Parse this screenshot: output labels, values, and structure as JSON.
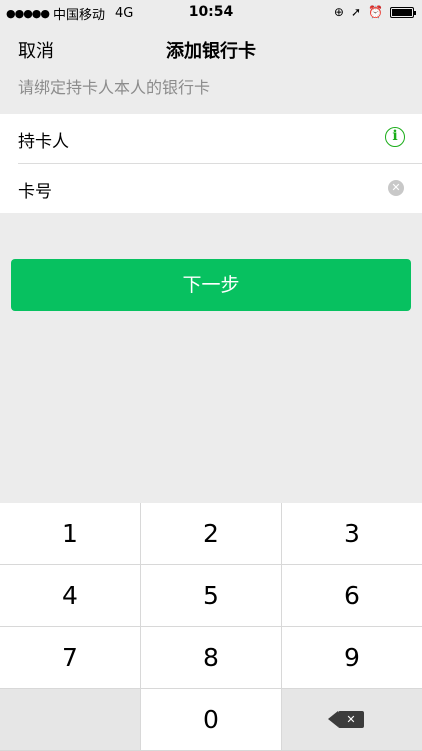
{
  "status_bar": {
    "signal_dots": "●●●●●",
    "carrier": "中国移动",
    "network": "4G",
    "time": "10:54",
    "icons": [
      "rotation-lock-icon",
      "location-arrow-icon",
      "alarm-icon",
      "battery-icon"
    ]
  },
  "nav": {
    "cancel_label": "取消",
    "title": "添加银行卡"
  },
  "subtitle": "请绑定持卡人本人的银行卡",
  "form": {
    "cardholder_label": "持卡人",
    "card_number_label": "卡号",
    "info_icon_glyph": "i",
    "clear_icon_glyph": "✕"
  },
  "next_button_label": "下一步",
  "keypad": {
    "keys": [
      "1",
      "2",
      "3",
      "4",
      "5",
      "6",
      "7",
      "8",
      "9",
      "",
      "0",
      "⌫"
    ]
  },
  "colors": {
    "accent": "#07c160",
    "background": "#ececec"
  }
}
